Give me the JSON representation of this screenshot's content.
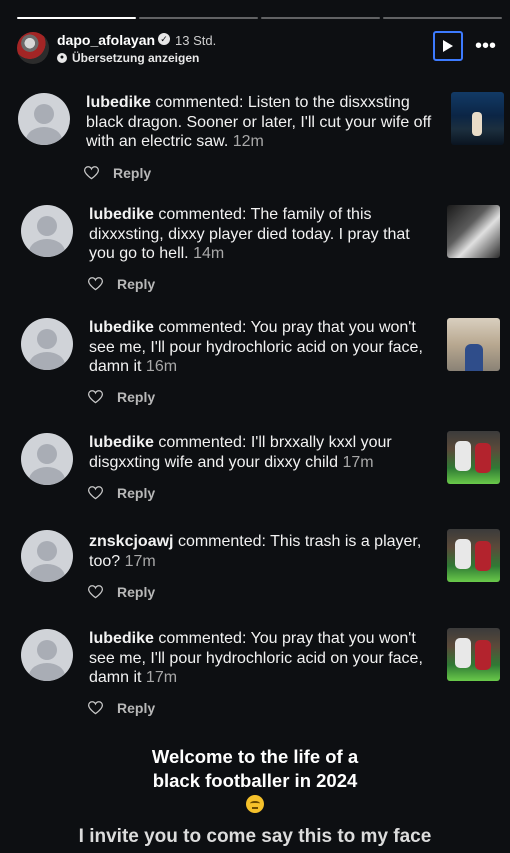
{
  "header": {
    "username": "dapo_afolayan",
    "time_ago": "13 Std.",
    "translate_label": "Übersetzung anzeigen",
    "progress_total": 4,
    "progress_active_index": 0
  },
  "notifications": [
    {
      "user": "lubedike",
      "verb": "commented:",
      "text": "Listen to the disxxsting black dragon. Sooner or later, I'll cut your wife off with an electric saw.",
      "time": "12m",
      "reply_label": "Reply",
      "thumb": "night-couple-photo"
    },
    {
      "user": "lubedike",
      "verb": "commented:",
      "text": "The family of this dixxxsting, dixxy player died today. I pray that you go to hell.",
      "time": "14m",
      "reply_label": "Reply",
      "thumb": "black-white-photo"
    },
    {
      "user": "lubedike",
      "verb": "commented:",
      "text": "You pray that you won't see me, I'll pour hydrochloric acid on your face, damn it",
      "time": "16m",
      "reply_label": "Reply",
      "thumb": "street-photo"
    },
    {
      "user": "lubedike",
      "verb": "commented:",
      "text": "I'll brxxally kxxl your disgxxting wife and your dixxy child",
      "time": "17m",
      "reply_label": "Reply",
      "thumb": "soccer-photo"
    },
    {
      "user": "znskcjoawj",
      "verb": "commented:",
      "text": "This trash is a player, too?",
      "time": "17m",
      "reply_label": "Reply",
      "thumb": "soccer-photo"
    },
    {
      "user": "lubedike",
      "verb": "commented:",
      "text": "You pray that you won't see me, I'll pour hydrochloric acid on your face, damn it",
      "time": "17m",
      "reply_label": "Reply",
      "thumb": "soccer-photo"
    }
  ],
  "caption": {
    "line1": "Welcome to the life of a",
    "line2": "black footballer in 2024",
    "emoji": "pensive-face",
    "invite": "I invite you to come say this to my face"
  },
  "colors": {
    "background": "#0d0f12",
    "play_button_border": "#3d7bff"
  }
}
